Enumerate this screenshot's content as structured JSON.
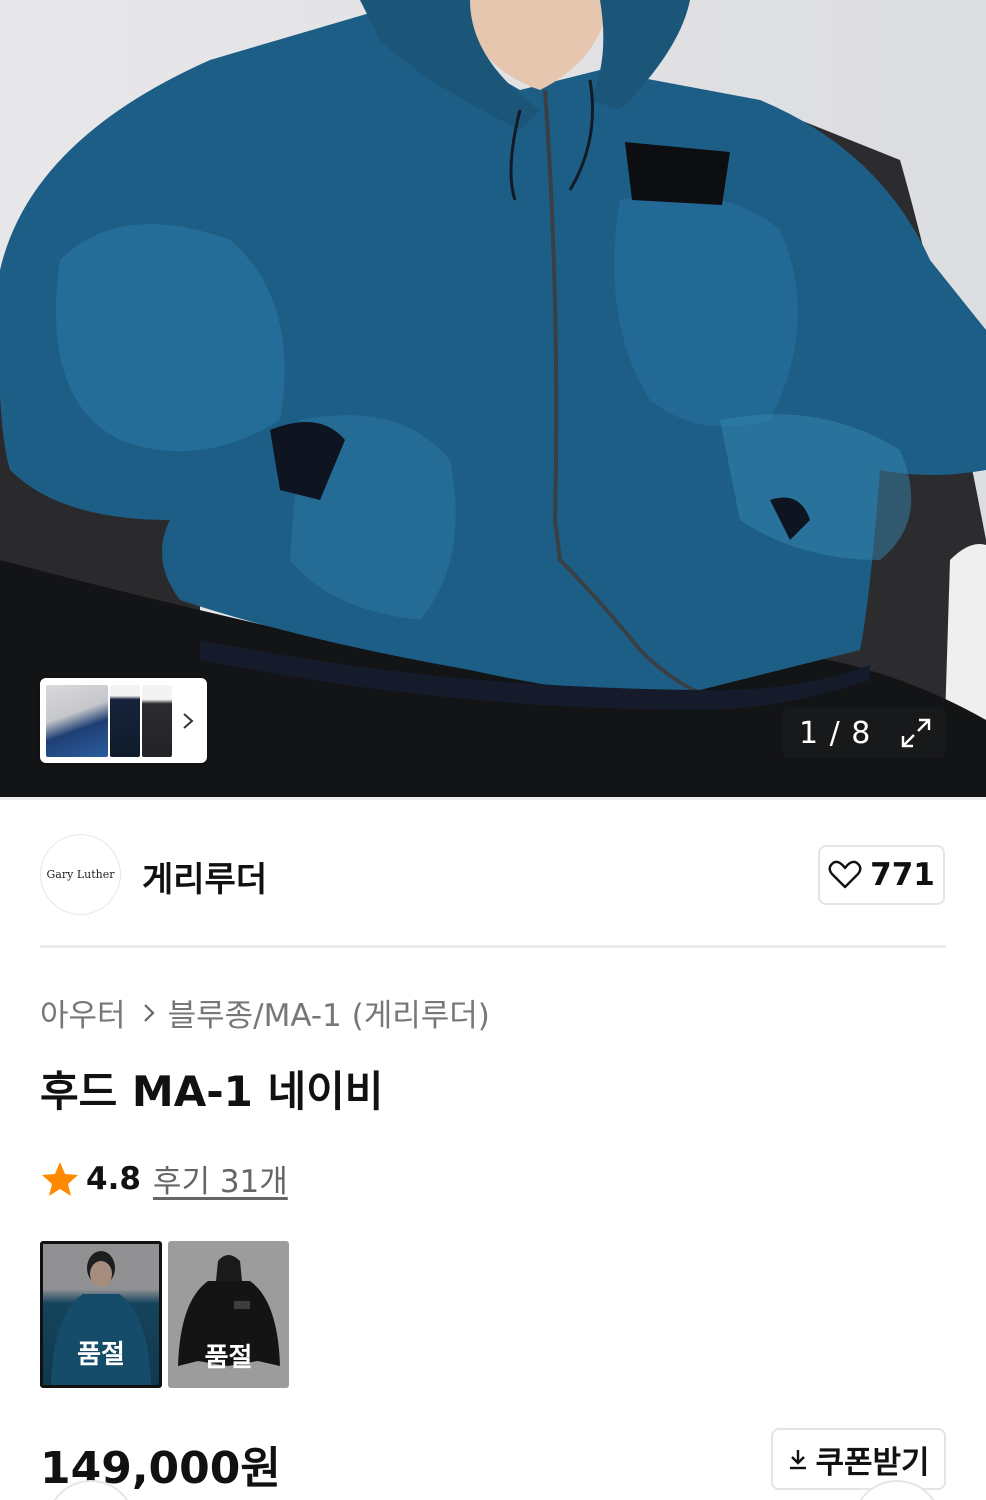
{
  "gallery": {
    "current": "1",
    "total": "8",
    "counter_text": "1 / 8",
    "thumbnails": [
      "thumbnail-1",
      "thumbnail-2",
      "thumbnail-3"
    ],
    "icons": {
      "next": "chevron-right-icon",
      "expand": "expand-icon"
    }
  },
  "brand": {
    "logo_text": "Gary Luther",
    "name": "게리루더",
    "like_count": "771",
    "like_icon": "heart-icon"
  },
  "product": {
    "breadcrumb": [
      "아우터",
      "블루종/MA-1 (게리루더)"
    ],
    "title": "후드 MA-1 네이비",
    "rating": "4.8",
    "reviews": "후기 31개",
    "rating_icon": "star-icon",
    "star_color": "#ff8a00",
    "options": [
      {
        "label": "품절",
        "selected": true
      },
      {
        "label": "품절",
        "selected": false
      }
    ],
    "price": "149,000원",
    "coupon_label": "쿠폰받기",
    "coupon_icon": "download-icon"
  }
}
